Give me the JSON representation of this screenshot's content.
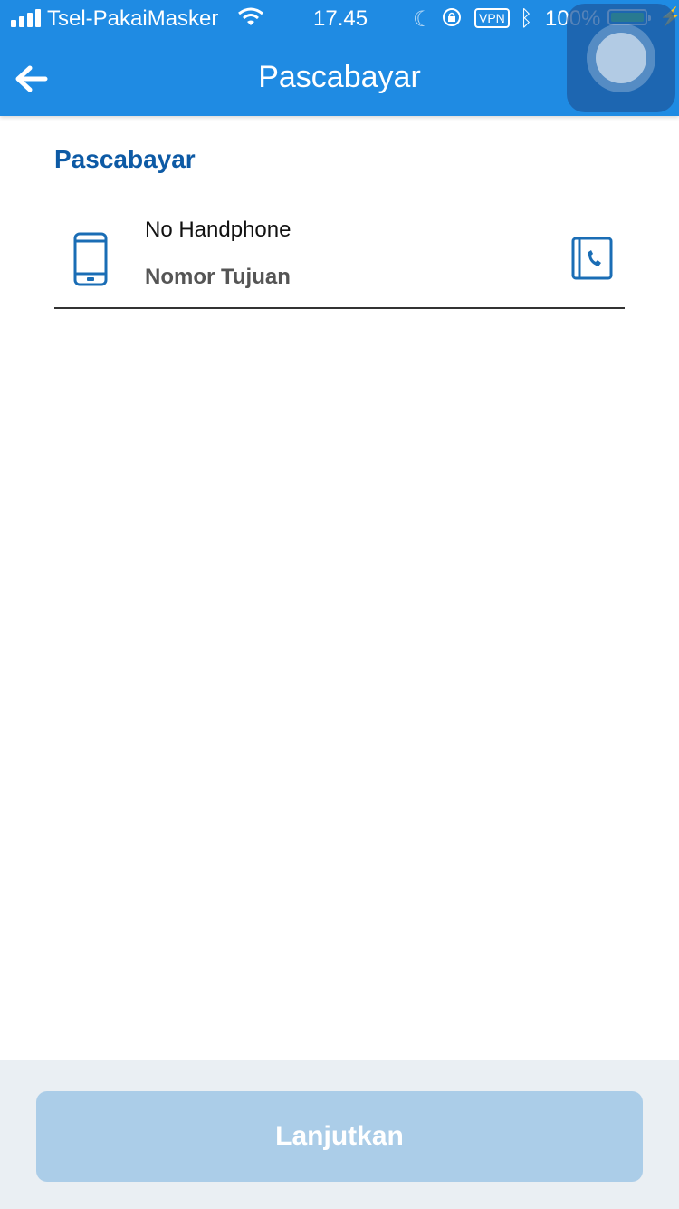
{
  "status_bar": {
    "carrier": "Tsel-PakaiMasker",
    "time": "17.45",
    "vpn": "VPN",
    "battery": "100%",
    "battery_level": 1.0,
    "icons": [
      "signal-icon",
      "wifi-icon",
      "moon-icon",
      "rotation-lock-icon",
      "vpn-badge",
      "bluetooth-icon",
      "battery-icon",
      "charging-icon"
    ]
  },
  "header": {
    "title": "Pascabayar",
    "back_icon": "arrow-left-icon",
    "background_color": "#1f8be3"
  },
  "form": {
    "section_title": "Pascabayar",
    "phone_field": {
      "label": "No Handphone",
      "placeholder": "Nomor Tujuan",
      "value": "",
      "leading_icon": "mobile-phone-icon",
      "trailing_icon": "contact-book-icon"
    }
  },
  "footer": {
    "continue_label": "Lanjutkan",
    "button_color": "#abcde8"
  },
  "colors": {
    "accent": "#1f8be3",
    "section_title": "#0d5aa5",
    "icon": "#1a6db5"
  }
}
